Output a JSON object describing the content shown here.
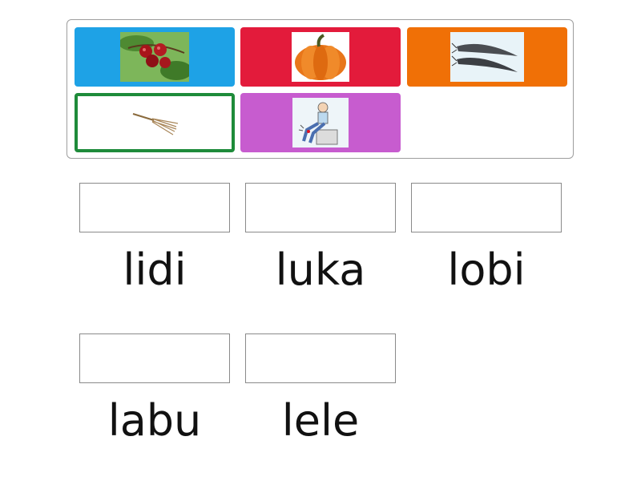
{
  "tiles": [
    {
      "picture": "red-berries-icon",
      "color": "#1ea2e6"
    },
    {
      "picture": "pumpkin-icon",
      "color": "#e31b3b"
    },
    {
      "picture": "catfish-icon",
      "color": "#f07006"
    },
    {
      "picture": "broom-icon",
      "color": "#ffffff",
      "selected": true
    },
    {
      "picture": "wounded-knee-icon",
      "color": "#c75ccf"
    }
  ],
  "words": [
    "lidi",
    "luka",
    "lobi",
    "labu",
    "lele"
  ]
}
